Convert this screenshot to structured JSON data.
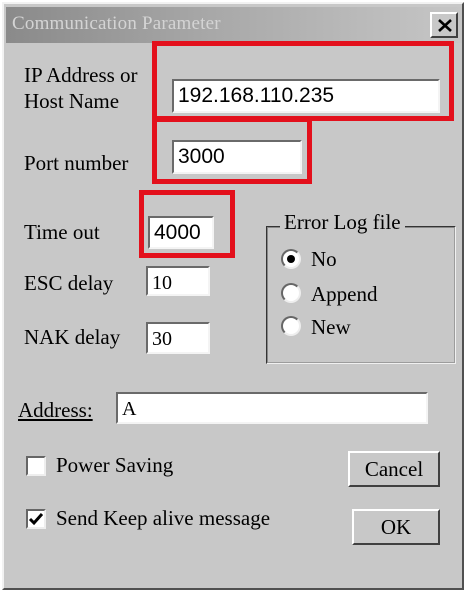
{
  "window": {
    "title": "Communication Parameter",
    "close_label": "×"
  },
  "fields": {
    "ip_label_line1": "IP Address or",
    "ip_label_line2": "Host Name",
    "ip_value": "192.168.110.235",
    "port_label": "Port number",
    "port_value": "3000",
    "timeout_label": "Time out",
    "timeout_value": "4000",
    "esc_label": "ESC delay",
    "esc_value": "10",
    "nak_label": "NAK delay",
    "nak_value": "30",
    "address_label": "Address:",
    "address_value": "A"
  },
  "error_log": {
    "legend": "Error Log file",
    "options": [
      {
        "label": "No",
        "selected": true
      },
      {
        "label": "Append",
        "selected": false
      },
      {
        "label": "New",
        "selected": false
      }
    ]
  },
  "checkboxes": [
    {
      "label": "Power Saving",
      "checked": false
    },
    {
      "label": "Send Keep alive message",
      "checked": true
    }
  ],
  "buttons": {
    "cancel": "Cancel",
    "ok": "OK"
  },
  "colors": {
    "dialog_bg": "#c8c8c8",
    "highlight": "#e3101c"
  }
}
